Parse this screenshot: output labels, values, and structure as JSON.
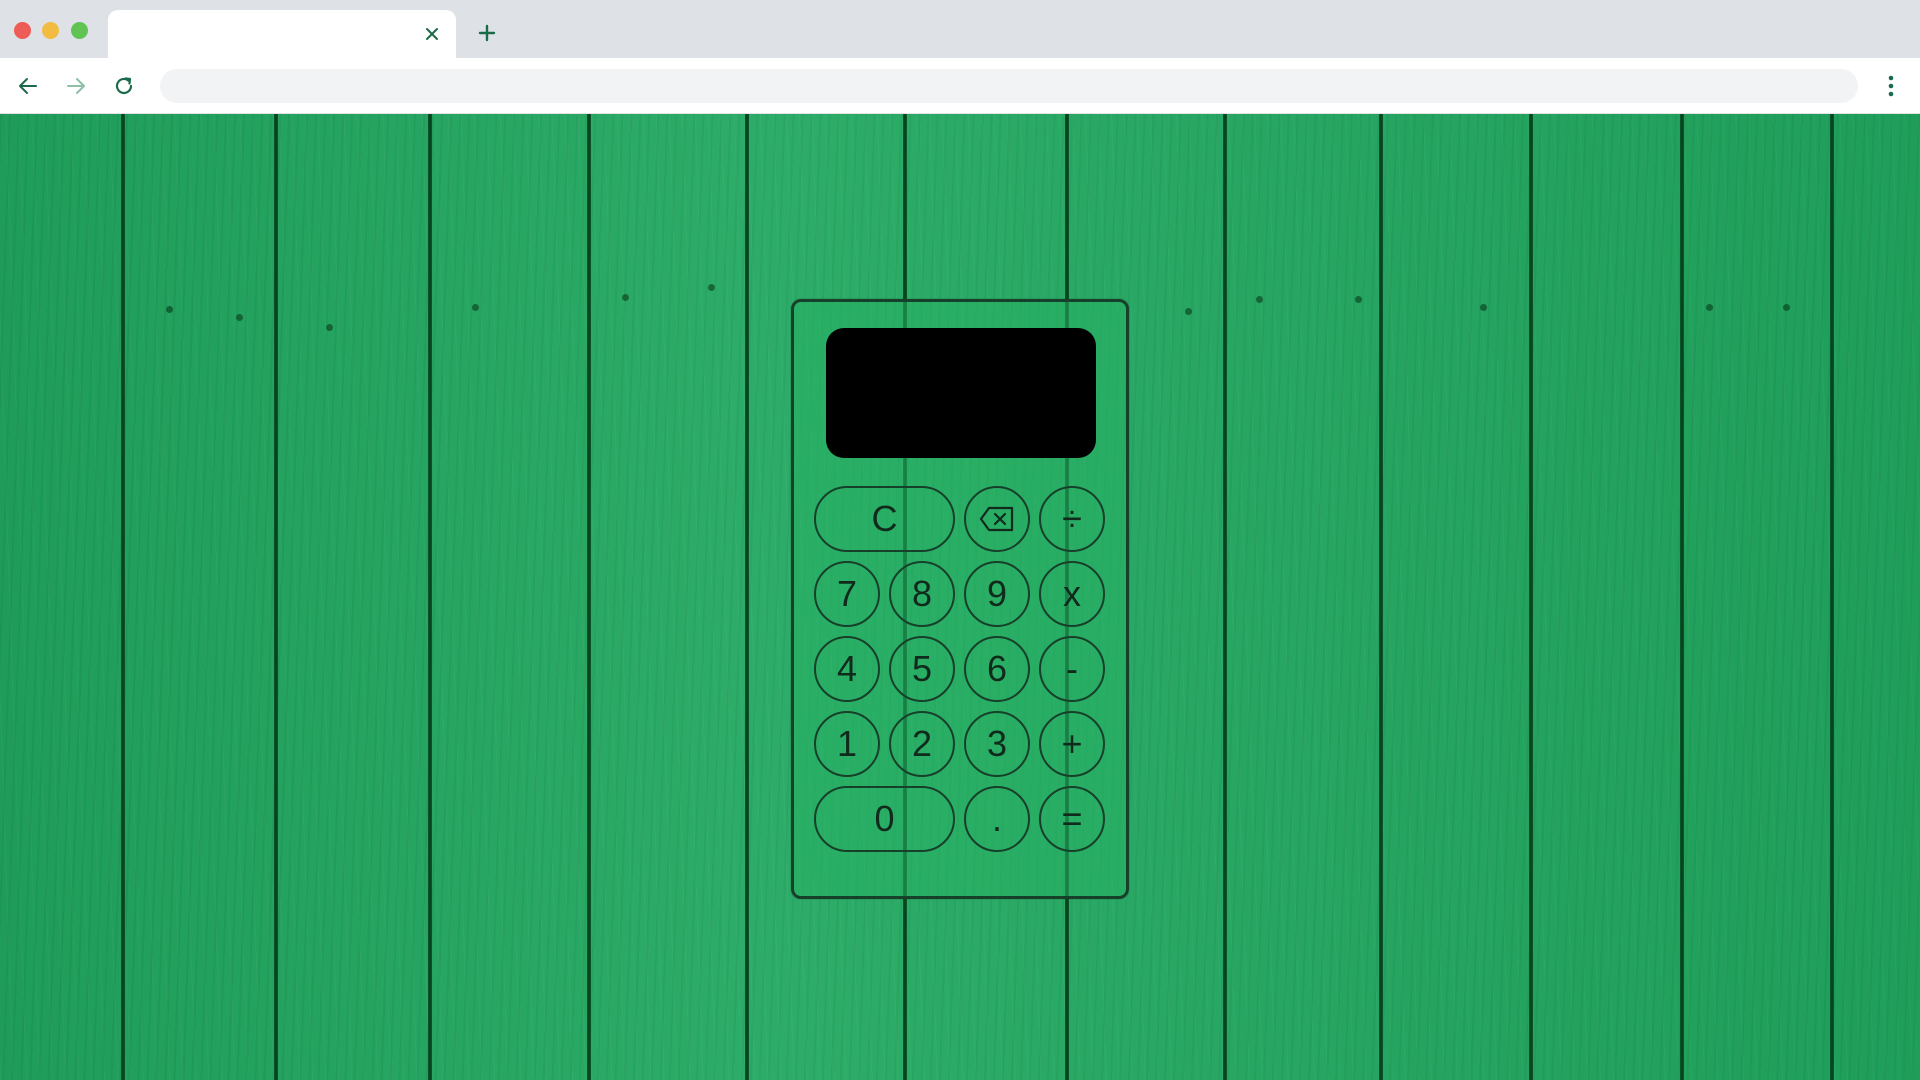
{
  "browser": {
    "tab_title": "",
    "address": "",
    "colors": {
      "tabstrip": "#dee1e6",
      "traffic_red": "#ee5c58",
      "traffic_yellow": "#f2bc42",
      "traffic_green": "#5fc454",
      "icon": "#1b6b4a"
    },
    "icons": {
      "close_tab": "close-icon",
      "new_tab": "plus-icon",
      "back": "arrow-left-icon",
      "forward": "arrow-right-icon",
      "reload": "reload-icon",
      "menu": "kebab-menu-icon"
    }
  },
  "calculator": {
    "display_value": "",
    "background_color": "#21a860",
    "rows": [
      [
        {
          "label": "C"
        },
        {
          "label": "",
          "icon": "backspace-icon"
        },
        {
          "label": "÷"
        }
      ],
      [
        {
          "label": "7"
        },
        {
          "label": "8"
        },
        {
          "label": "9"
        },
        {
          "label": "x"
        }
      ],
      [
        {
          "label": "4"
        },
        {
          "label": "5"
        },
        {
          "label": "6"
        },
        {
          "label": "-"
        }
      ],
      [
        {
          "label": "1"
        },
        {
          "label": "2"
        },
        {
          "label": "3"
        },
        {
          "label": "+"
        }
      ],
      [
        {
          "label": "0"
        },
        {
          "label": "."
        },
        {
          "label": "="
        }
      ]
    ]
  }
}
